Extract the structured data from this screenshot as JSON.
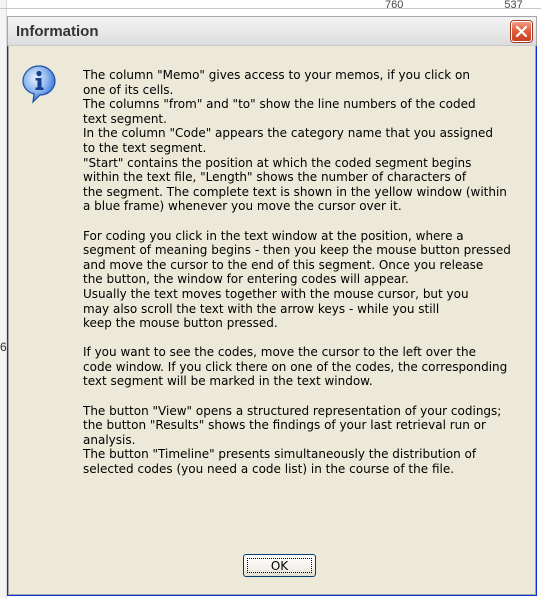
{
  "background": {
    "fragments": [
      "760",
      "537"
    ],
    "stray_char": "6"
  },
  "dialog": {
    "title": "Information",
    "close_icon": "close-icon",
    "info_icon": "information-icon",
    "message_lines": [
      "The column \"Memo\" gives access to your memos, if you click on",
      "one of its cells.",
      "The columns \"from\" and \"to\" show the line numbers of the coded",
      "text segment.",
      "In the column \"Code\" appears the category name that you assigned",
      "to the text segment.",
      "\"Start\" contains the position at which the coded segment begins",
      "within the text file, \"Length\" shows the number of characters of",
      "the segment. The complete text is shown in the yellow window (within",
      "a blue frame) whenever you move the cursor over it.",
      "",
      "For coding you click in the text window at the position, where a",
      "segment of meaning begins - then you keep the mouse button pressed",
      "and move the cursor to the end of this segment. Once you release",
      "the button, the window for entering codes will appear.",
      "Usually the text moves together with the mouse cursor, but you",
      "may also scroll the text with the arrow keys - while you still",
      "keep the mouse button pressed.",
      "",
      "If you want to see the codes, move the cursor to the left over the",
      "code window. If you click there on one of the codes, the corresponding",
      "text segment will be marked in the text window.",
      "",
      "The button \"View\" opens a structured representation of your codings;",
      "the button \"Results\" shows the findings of your last retrieval run or",
      "analysis.",
      "The button \"Timeline\" presents simultaneously the distribution of",
      "selected codes (you need a code list) in the course of the file."
    ],
    "ok_label": "OK"
  },
  "colors": {
    "dialog_bg": "#ece9d8",
    "close_red": "#e2603f",
    "info_blue": "#2f6fd6"
  }
}
